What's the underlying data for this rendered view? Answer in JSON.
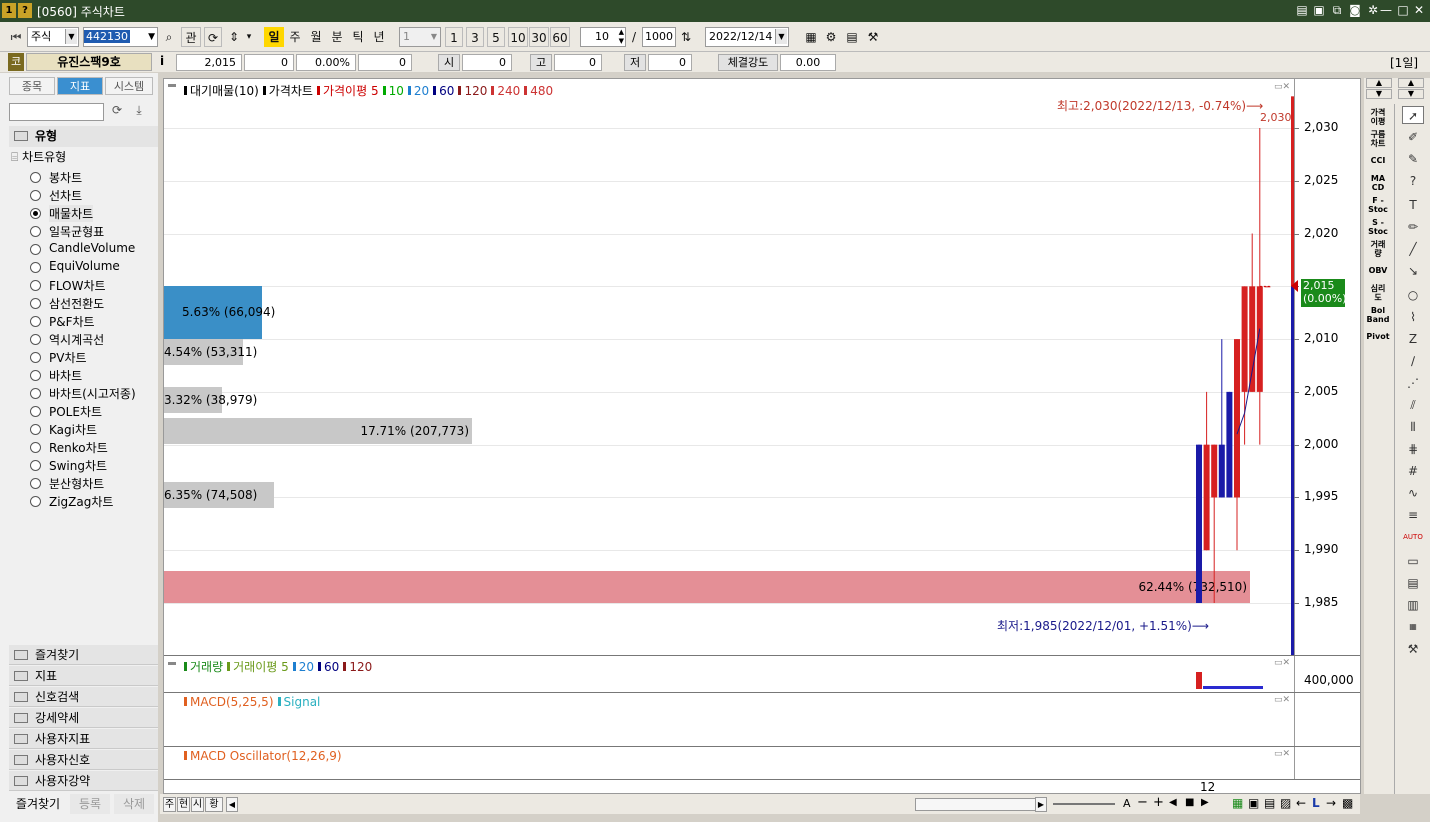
{
  "window": {
    "title": "[0560] 주식차트",
    "icons": [
      "1",
      "?"
    ]
  },
  "toolbar": {
    "market": "주식",
    "code": "442130",
    "btn_gwan": "관",
    "periods": [
      "일",
      "주",
      "월",
      "분",
      "틱",
      "년"
    ],
    "active_period": "일",
    "interval_value": "1",
    "quick_intervals": [
      "1",
      "3",
      "5",
      "10",
      "30",
      "60"
    ],
    "count_value": "10",
    "divider": "/",
    "total_count": "1000",
    "date": "2022/12/14"
  },
  "infobar": {
    "market_tag": "코",
    "name": "유진스팩9호",
    "info_icon": "i",
    "price": "2,015",
    "change": "0",
    "change_pct": "0.00%",
    "volume": "0",
    "open_label": "시",
    "open": "0",
    "high_label": "고",
    "high": "0",
    "low_label": "저",
    "low": "0",
    "strength_label": "체결강도",
    "strength": "0.00",
    "period_badge": "[1일]"
  },
  "left": {
    "tabs": [
      "종목",
      "지표",
      "시스템"
    ],
    "active_tab": "지표",
    "group_title": "유형",
    "subgroup": "차트유형",
    "chart_types": [
      "봉차트",
      "선차트",
      "매물차트",
      "일목균형표",
      "CandleVolume",
      "EquiVolume",
      "FLOW차트",
      "삼선전환도",
      "P&F차트",
      "역시계곡선",
      "PV차트",
      "바차트",
      "바차트(시고저종)",
      "POLE차트",
      "Kagi차트",
      "Renko차트",
      "Swing차트",
      "분산형차트",
      "ZigZag차트"
    ],
    "selected_type": "매물차트",
    "bottom_groups": [
      "즐겨찾기",
      "지표",
      "신호검색",
      "강세약세",
      "사용자지표",
      "사용자신호",
      "사용자강약"
    ],
    "bottom_tabs": [
      "즐겨찾기",
      "등록",
      "삭제"
    ]
  },
  "chart": {
    "legend_main": [
      "대기매물(10)",
      "가격차트",
      "가격이평 5",
      "10",
      "20",
      "60",
      "120",
      "240",
      "480"
    ],
    "legend_colors": [
      "#000000",
      "#000000",
      "#cc0000",
      "#00aa00",
      "#1e7fd0",
      "#000080",
      "#8b1a1a",
      "#cc3333",
      "#cc3333"
    ],
    "high_annotation": "최고:2,030(2022/12/13, -0.74%)",
    "low_annotation": "최저:1,985(2022/12/01, +1.51%)",
    "high_tag": "2,030",
    "current_tag": "2,015",
    "current_tag_pct": "(0.00%)",
    "y_ticks": [
      "2,030",
      "2,025",
      "2,020",
      "2,015",
      "2,010",
      "2,005",
      "2,000",
      "1,995",
      "1,990",
      "1,985"
    ],
    "x_tick": "12",
    "volume_legend": [
      "거래량",
      "거래이평 5",
      "20",
      "60",
      "120"
    ],
    "volume_tick": "400,000",
    "macd_legend": [
      "MACD(5,25,5)",
      "Signal"
    ],
    "osc_legend": [
      "MACD Oscillator(12,26,9)"
    ]
  },
  "chart_data": {
    "type": "bar",
    "title": "",
    "xlabel": "",
    "ylabel": "",
    "ylim": [
      1983,
      2033
    ],
    "volume_profile": [
      {
        "label": "5.63% (66,094)",
        "pct": 5.63,
        "volume": 66094,
        "price_low": 2010,
        "price_high": 2015,
        "color": "#3a8fc7"
      },
      {
        "label": "4.54% (53,311)",
        "pct": 4.54,
        "volume": 53311,
        "price_low": 2007.5,
        "price_high": 2010,
        "color": "#c8c8c8"
      },
      {
        "label": "3.32% (38,979)",
        "pct": 3.32,
        "volume": 38979,
        "price_low": 2003,
        "price_high": 2005.5,
        "color": "#c8c8c8"
      },
      {
        "label": "17.71% (207,773)",
        "pct": 17.71,
        "volume": 207773,
        "price_low": 2000,
        "price_high": 2002.5,
        "color": "#c8c8c8"
      },
      {
        "label": "6.35% (74,508)",
        "pct": 6.35,
        "volume": 74508,
        "price_low": 1994,
        "price_high": 1996.5,
        "color": "#c8c8c8"
      },
      {
        "label": "62.44% (732,510)",
        "pct": 62.44,
        "volume": 732510,
        "price_low": 1985,
        "price_high": 1988,
        "color": "#e48f96"
      }
    ],
    "candles": [
      {
        "open": 2000,
        "close": 1985,
        "high": 2000,
        "low": 1985
      },
      {
        "open": 1990,
        "close": 2000,
        "high": 2005,
        "low": 1990
      },
      {
        "open": 1995,
        "close": 2000,
        "high": 2000,
        "low": 1985
      },
      {
        "open": 2000,
        "close": 1995,
        "high": 2010,
        "low": 1995
      },
      {
        "open": 2005,
        "close": 1995,
        "high": 2005,
        "low": 1995
      },
      {
        "open": 1995,
        "close": 2010,
        "high": 2010,
        "low": 1990
      },
      {
        "open": 2005,
        "close": 2015,
        "high": 2015,
        "low": 2000
      },
      {
        "open": 2005,
        "close": 2015,
        "high": 2020,
        "low": 2005
      },
      {
        "open": 2005,
        "close": 2015,
        "high": 2030,
        "low": 2000
      },
      {
        "open": 2015,
        "close": 2015,
        "high": 2015,
        "low": 2015
      }
    ],
    "ma5": [
      2001,
      2003,
      2007,
      2011
    ]
  },
  "colors": {
    "title_bg": "#2e4a2a",
    "up": "#d62020",
    "down": "#1a1aa8",
    "tab_active": "#3a8fd0",
    "current_price_bg": "#1a8a1a"
  }
}
